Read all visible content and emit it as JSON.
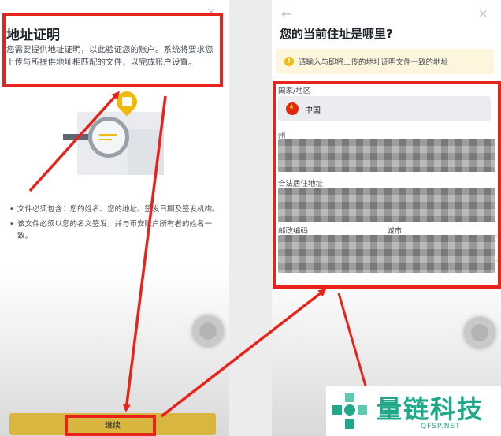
{
  "left_screen": {
    "close_icon": "×",
    "title": "地址证明",
    "description": "您需要提供地址证明，以此验证您的账户。系统将要求您上传与所提供地址相匹配的文件，以完成账户设置。",
    "bullets": [
      "文件必须包含：您的姓名、您的地址、签发日期及签发机构。",
      "该文件必须以您的名义签发，并与币安账户所有者的姓名一致。"
    ],
    "continue_label": "继续"
  },
  "right_screen": {
    "back_icon": "←",
    "close_icon": "×",
    "title": "您的当前住址是哪里?",
    "notice_icon": "!",
    "notice": "请输入与即将上传的地址证明文件一致的地址",
    "country_label": "国家/地区",
    "country_value": "中国",
    "flag_star": "★",
    "state_label": "州",
    "address_label": "合法居住地址",
    "postal_label": "邮政编码",
    "city_label": "城市"
  },
  "watermark": {
    "text": "量链科技",
    "sub": "QFSP.NET"
  },
  "colors": {
    "highlight": "#e8231b",
    "accent": "#f0b90b",
    "watermark": "#1fa88a"
  }
}
